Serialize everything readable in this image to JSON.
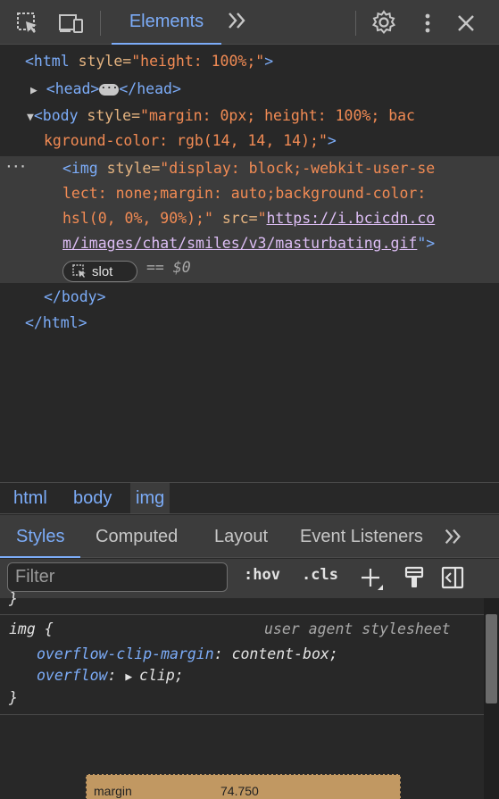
{
  "toolbar": {
    "icons": [
      "inspect-element-icon",
      "device-toolbar-icon",
      "settings-gear-icon",
      "more-vertical-icon",
      "close-icon"
    ],
    "active_tab": "Elements",
    "more_tabs": "»"
  },
  "dom_tree": {
    "html_open": {
      "tag": "<html",
      "attr": " style=",
      "value": "\"height: 100%;\"",
      "close": ">"
    },
    "head": {
      "open": "<head>",
      "close": "</head>"
    },
    "body_open": {
      "tag": "<body",
      "attr": " style=",
      "value_line1": "\"margin: 0px; height: 100%; bac",
      "value_line2": "kground-color: rgb(14, 14, 14);\"",
      "close": ">"
    },
    "img": {
      "tag": "<img",
      "attr_style": " style=",
      "style_l1": "\"display: block;-webkit-user-se",
      "style_l2": "lect: none;margin: auto;background-color:",
      "style_l3": "hsl(0, 0%, 90%);\"",
      "attr_src": " src=",
      "quote": "\"",
      "src_l1": "https://i.bcicdn.co",
      "src_l2": "m/images/chat/smiles/v3/masturbating.gif",
      "close": "\">"
    },
    "slot_label": "slot",
    "selected_marker": "== $0",
    "body_close": "</body>",
    "html_close": "</html>",
    "row_ellipsis": "···"
  },
  "breadcrumbs": [
    "html",
    "body",
    "img"
  ],
  "styles_tabs": [
    "Styles",
    "Computed",
    "Layout",
    "Event Listeners"
  ],
  "styles_tabs_more": "»",
  "filter": {
    "placeholder": "Filter",
    "hov": ":hov",
    "cls": ".cls"
  },
  "rules": {
    "prev_brace": "}",
    "selector": "img {",
    "source": "user agent stylesheet",
    "props": [
      {
        "name": "overflow-clip-margin",
        "value": "content-box;"
      },
      {
        "name": "overflow",
        "value": "clip;"
      }
    ],
    "close_brace": "}"
  },
  "box_model": {
    "label": "margin",
    "value": "74.750"
  }
}
